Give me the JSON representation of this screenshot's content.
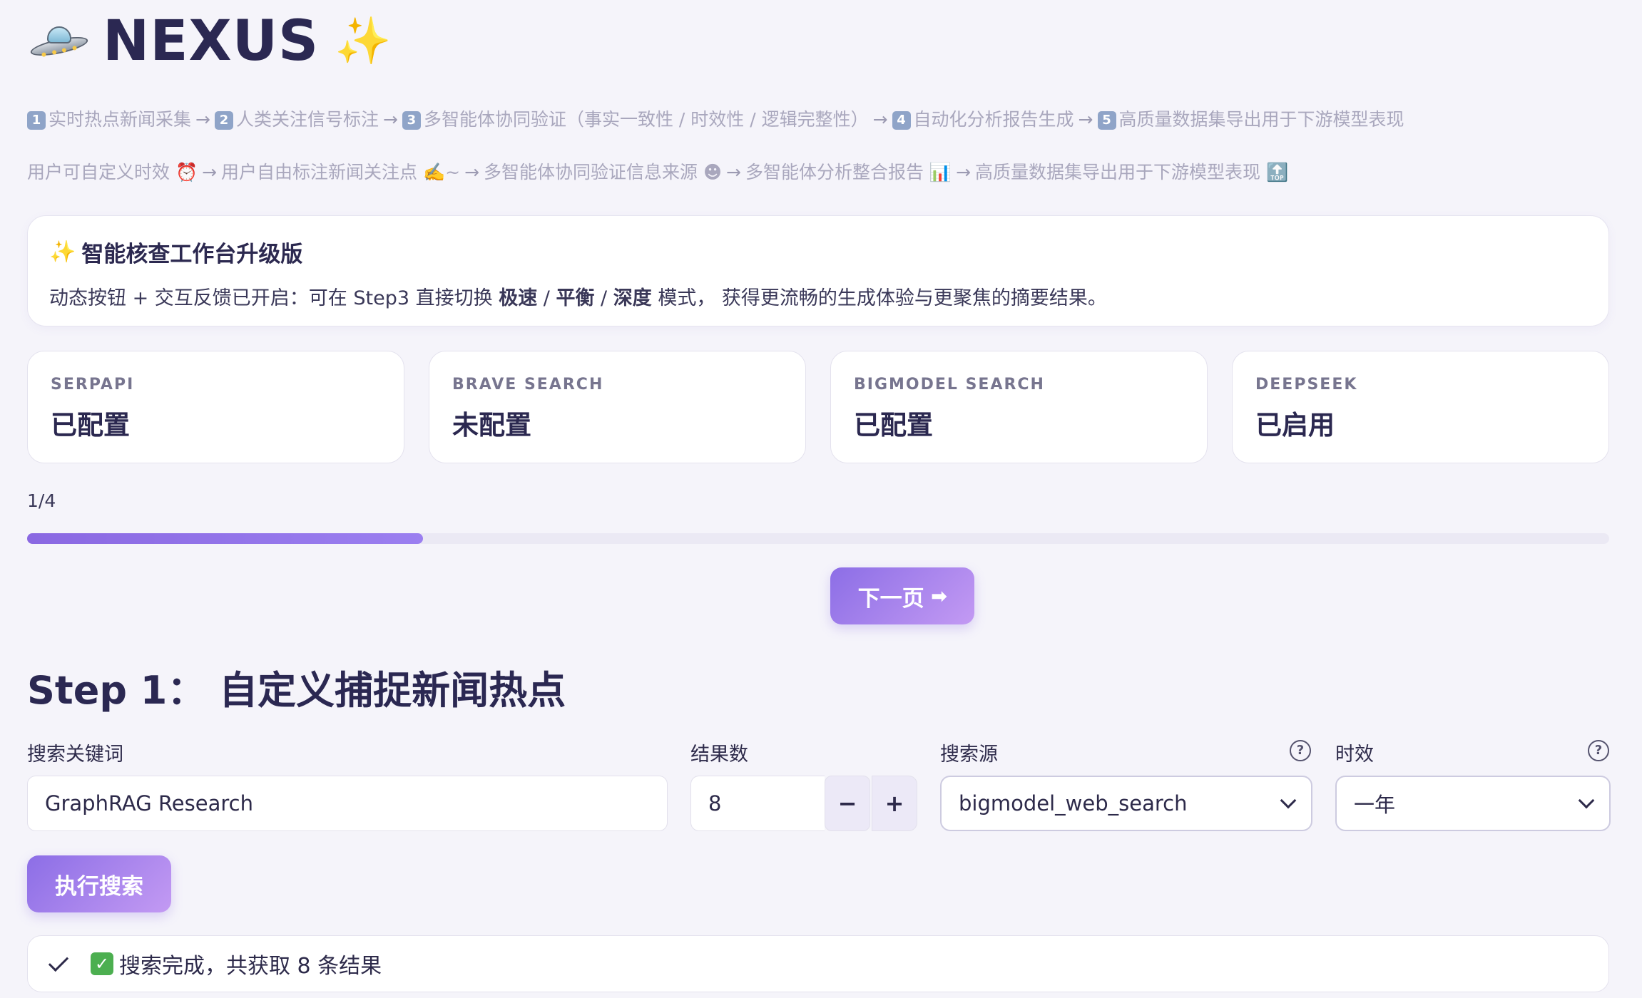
{
  "header": {
    "title": "NEXUS",
    "logo_icon": "ufo-icon",
    "title_icon": "sparkles-icon"
  },
  "pipeline": {
    "line1": [
      {
        "num": "1",
        "text": "实时热点新闻采集"
      },
      {
        "num": "2",
        "text": "人类关注信号标注"
      },
      {
        "num": "3",
        "text": "多智能体协同验证（事实一致性 / 时效性 / 逻辑完整性）"
      },
      {
        "num": "4",
        "text": "自动化分析报告生成"
      },
      {
        "num": "5",
        "text": "高质量数据集导出用于下游模型表现"
      }
    ],
    "line2": [
      {
        "text": "用户可自定义时效 ⏰"
      },
      {
        "text": "用户自由标注新闻关注点 ✍️~"
      },
      {
        "text": "多智能体协同验证信息来源 ☻"
      },
      {
        "text": "多智能体分析整合报告 📊"
      },
      {
        "text": "高质量数据集导出用于下游模型表现 🔝"
      }
    ],
    "arrow": "→"
  },
  "banner": {
    "title": "智能核查工作台升级版",
    "text_before": "动态按钮 + 交互反馈已开启：可在 Step3 直接切换 ",
    "mode_fast": "极速",
    "sep": " / ",
    "mode_balanced": "平衡",
    "mode_deep": "深度",
    "text_after": " 模式， 获得更流畅的生成体验与更聚焦的摘要结果。"
  },
  "status_cards": [
    {
      "label": "SERPAPI",
      "value": "已配置"
    },
    {
      "label": "BRAVE SEARCH",
      "value": "未配置"
    },
    {
      "label": "BIGMODEL SEARCH",
      "value": "已配置"
    },
    {
      "label": "DEEPSEEK",
      "value": "已启用"
    }
  ],
  "pagination": {
    "page_text": "1/4",
    "progress": 0.25,
    "next_label": "下一页",
    "next_icon": "➡"
  },
  "step1": {
    "title": "Step 1： 自定义捕捉新闻热点",
    "keyword_label": "搜索关键词",
    "keyword_value": "GraphRAG Research",
    "count_label": "结果数",
    "count_value": "8",
    "minus": "−",
    "plus": "+",
    "source_label": "搜索源",
    "source_value": "bigmodel_web_search",
    "time_label": "时效",
    "time_value": "一年",
    "help": "?",
    "exec_label": "执行搜索",
    "result_text": "搜索完成，共获取 8 条结果"
  }
}
